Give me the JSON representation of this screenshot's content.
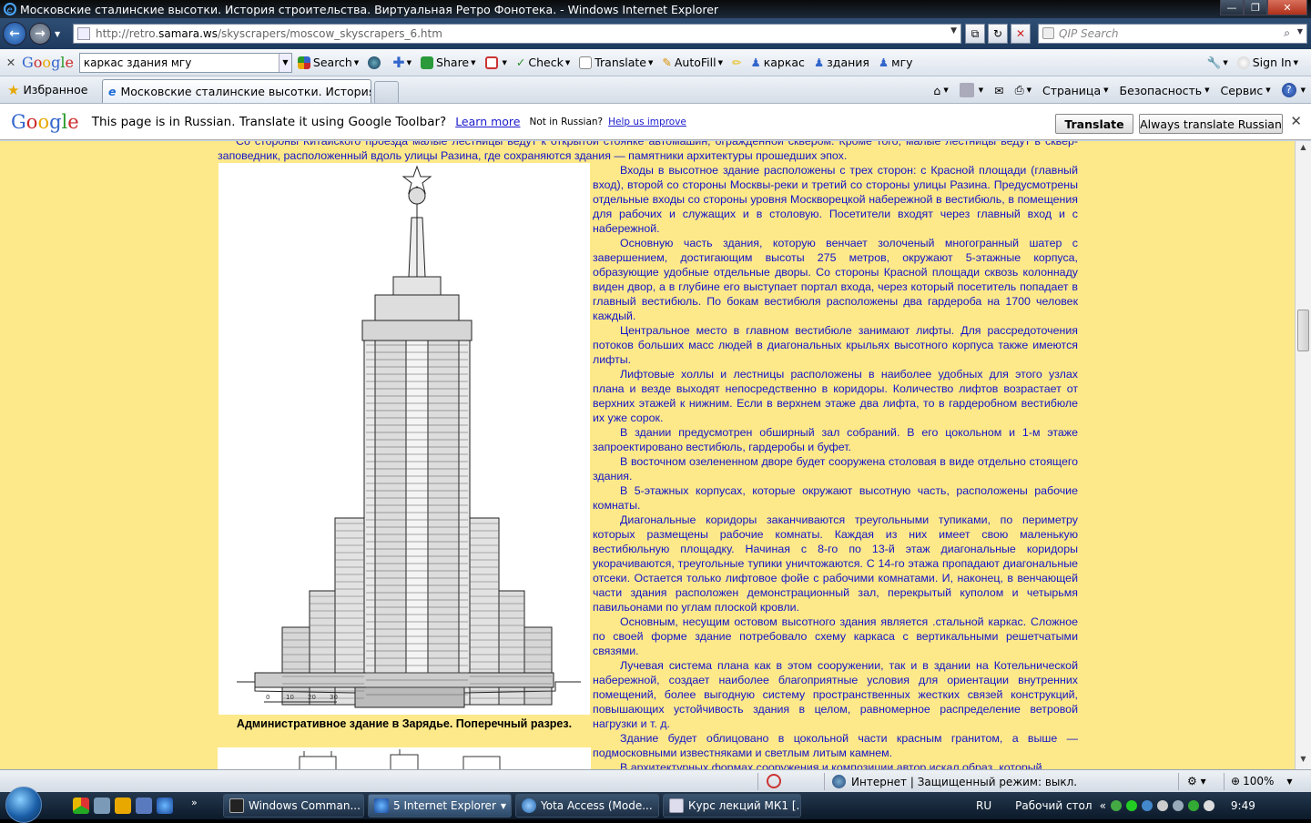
{
  "window": {
    "title": "Московские сталинские высотки. История строительства. Виртуальная Ретро Фонотека. - Windows Internet Explorer",
    "min": "—",
    "max": "❐",
    "close": "✕"
  },
  "address": {
    "url_prefix": "http://retro.",
    "url_host": "samara.ws",
    "url_path": "/skyscrapers/moscow_skyscrapers_6.htm",
    "search_placeholder": "QIP Search"
  },
  "google_toolbar": {
    "query": "каркас здания мгу",
    "items": [
      "Search",
      "Share",
      "Check",
      "Translate",
      "AutoFill",
      "каркас",
      "здания",
      "мгу"
    ],
    "sign_in": "Sign In"
  },
  "favorites": {
    "label": "Избранное",
    "tab_title": "Московские сталинские высотки. История стр...",
    "commands": [
      "Страница",
      "Безопасность",
      "Сервис"
    ]
  },
  "translate_bar": {
    "message": "This page is in Russian.  Translate it using Google Toolbar?",
    "learn_more": "Learn more",
    "not_in": "Not in Russian?",
    "help": "Help us improve",
    "translate_btn": "Translate",
    "always_btn": "Always translate Russian"
  },
  "page": {
    "intro": "Со стороны Китайского проезда малые лестницы ведут к открытой стоянке автомашин, ограждённой сквером. Кроме того, малые лестницы ведут в сквер-заповедник, расположенный вдоль улицы Разина, где сохраняются здания — памятники архитектуры прошедших эпох.",
    "caption": "Административное здание в Зарядье. Поперечный разрез.",
    "scale_labels": [
      "0",
      "10",
      "20",
      "30"
    ],
    "paragraphs": [
      "Входы в высотное здание расположены с трех сторон: с Красной площади (главный вход), второй со стороны Москвы-реки и третий со стороны улицы Разина. Предусмотрены отдельные входы со стороны уровня Москворецкой набережной в вестибюль, в помещения для рабочих и служащих и в столовую. Посетители входят через главный вход и с набережной.",
      "Основную часть здания, которую венчает золоченый многогранный шатер с завершением, достигающим высоты 275 метров, окружают 5-этажные корпуса, образующие удобные отдельные дворы. Со стороны Красной площади сквозь колоннаду виден двор, а в глубине его выступает портал входа, через который посетитель попадает в главный вестибюль. По бокам вестибюля расположены два гардероба на 1700 человек каждый.",
      "Центральное место в главном вестибюле занимают лифты. Для рассредоточения потоков больших масс людей в диагональных крыльях высотного корпуса также имеются лифты.",
      "Лифтовые холлы и лестницы расположены в наиболее удобных для этого узлах плана и везде выходят непосредственно в коридоры. Количество лифтов возрастает от верхних этажей к нижним. Если в верхнем этаже два лифта, то в гардеробном вестибюле их уже сорок.",
      "В здании предусмотрен обширный зал собраний. В его цокольном и 1-м этаже запроектировано вестибюль, гардеробы и буфет.",
      "В восточном озелененном дворе будет сооружена столовая в виде отдельно стоящего здания.",
      "В 5-этажных корпусах, которые окружают высотную часть, расположены рабочие комнаты.",
      "Диагональные коридоры заканчиваются треугольными тупиками, по периметру которых размещены рабочие комнаты. Каждая из них имеет свою маленькую вестибюльную площадку. Начиная с 8-го по 13-й этаж диагональные коридоры укорачиваются, треугольные тупики уничтожаются. С 14-го этажа пропадают диагональные отсеки. Остается только лифтовое фойе с рабочими комнатами. И, наконец, в венчающей части здания расположен демонстрационный зал, перекрытый куполом и четырьмя павильонами по углам плоской кровли.",
      "Основным, несущим остовом высотного здания является .стальной каркас. Сложное по своей форме здание потребовало схему каркаса с вертикальными решетчатыми связями.",
      "Лучевая система плана как в этом сооружении, так и в здании на Котельнической набережной, создает наиболее благоприятные условия для ориентации внутренних помещений, более выгодную систему пространственных жестких связей конструкций, повышающих устойчивость здания в целом, равномерное распределение ветровой нагрузки и т. д.",
      "Здание будет облицовано в цокольной части красным гранитом, а выше — подмосковными известняками и светлым литым камнем.",
      "В архитектурных формах сооружения и композиции автор искал образ, который"
    ]
  },
  "status": {
    "zone": "Интернет | Защищенный режим: выкл.",
    "zoom": "100%"
  },
  "taskbar": {
    "buttons": [
      "Windows Comman...",
      "5 Internet Explorer",
      "Yota Access (Mode...",
      "Курс лекций МК1 [..."
    ],
    "lang": "RU",
    "desktop": "Рабочий стол",
    "time": "9:49"
  },
  "colors": {
    "page_bg": "#fde98a",
    "text": "#1414c8",
    "link": "#1a1acc"
  }
}
